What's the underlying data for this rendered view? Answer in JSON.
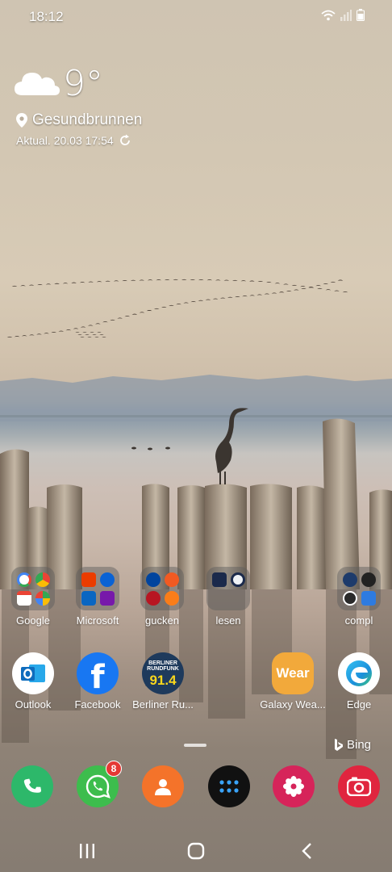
{
  "status_bar": {
    "time": "18:12"
  },
  "weather": {
    "temperature": "9°",
    "location": "Gesundbrunnen",
    "updated": "Aktual. 20.03 17:54"
  },
  "folders": [
    {
      "label": "Google",
      "icons": [
        "google-search-icon",
        "chrome-icon",
        "gmail-icon",
        "maps-icon"
      ]
    },
    {
      "label": "Microsoft",
      "icons": [
        "office-icon",
        "onedrive-icon",
        "linkedin-icon",
        "onenote-icon"
      ]
    },
    {
      "label": "gucken",
      "icons": [
        "ard-icon",
        "arte-icon",
        "ard-mediathek-icon",
        "zdf-icon"
      ]
    },
    {
      "label": "lesen",
      "icons": [
        "news-app-1-icon",
        "news-app-2-icon"
      ]
    },
    {
      "label": "compl",
      "icons": [
        "app-settings-icon",
        "pen-icon",
        "at-icon",
        "shield-icon"
      ]
    }
  ],
  "apps": [
    {
      "label": "Outlook",
      "icon": "outlook-icon"
    },
    {
      "label": "Facebook",
      "icon": "facebook-icon"
    },
    {
      "label": "Berliner Ru...",
      "icon": "berliner-rundfunk-icon",
      "icon_text_top": "BERLINER",
      "icon_text_mid": "RUNDFUNK",
      "icon_text_big": "91.4"
    },
    {
      "label": "Galaxy Wea...",
      "icon": "galaxy-wearable-icon",
      "icon_text": "Wear"
    },
    {
      "label": "Edge",
      "icon": "edge-icon"
    }
  ],
  "bing_label": "Bing",
  "dock": [
    {
      "icon": "phone-icon",
      "color": "#2db86a"
    },
    {
      "icon": "whatsapp-icon",
      "color": "#3dbd4d",
      "badge": "8"
    },
    {
      "icon": "contacts-icon",
      "color": "#f4732a"
    },
    {
      "icon": "app-drawer-icon",
      "color": "#111111"
    },
    {
      "icon": "gallery-icon",
      "color": "#d6245a"
    },
    {
      "icon": "camera-icon",
      "color": "#e0253f"
    }
  ]
}
